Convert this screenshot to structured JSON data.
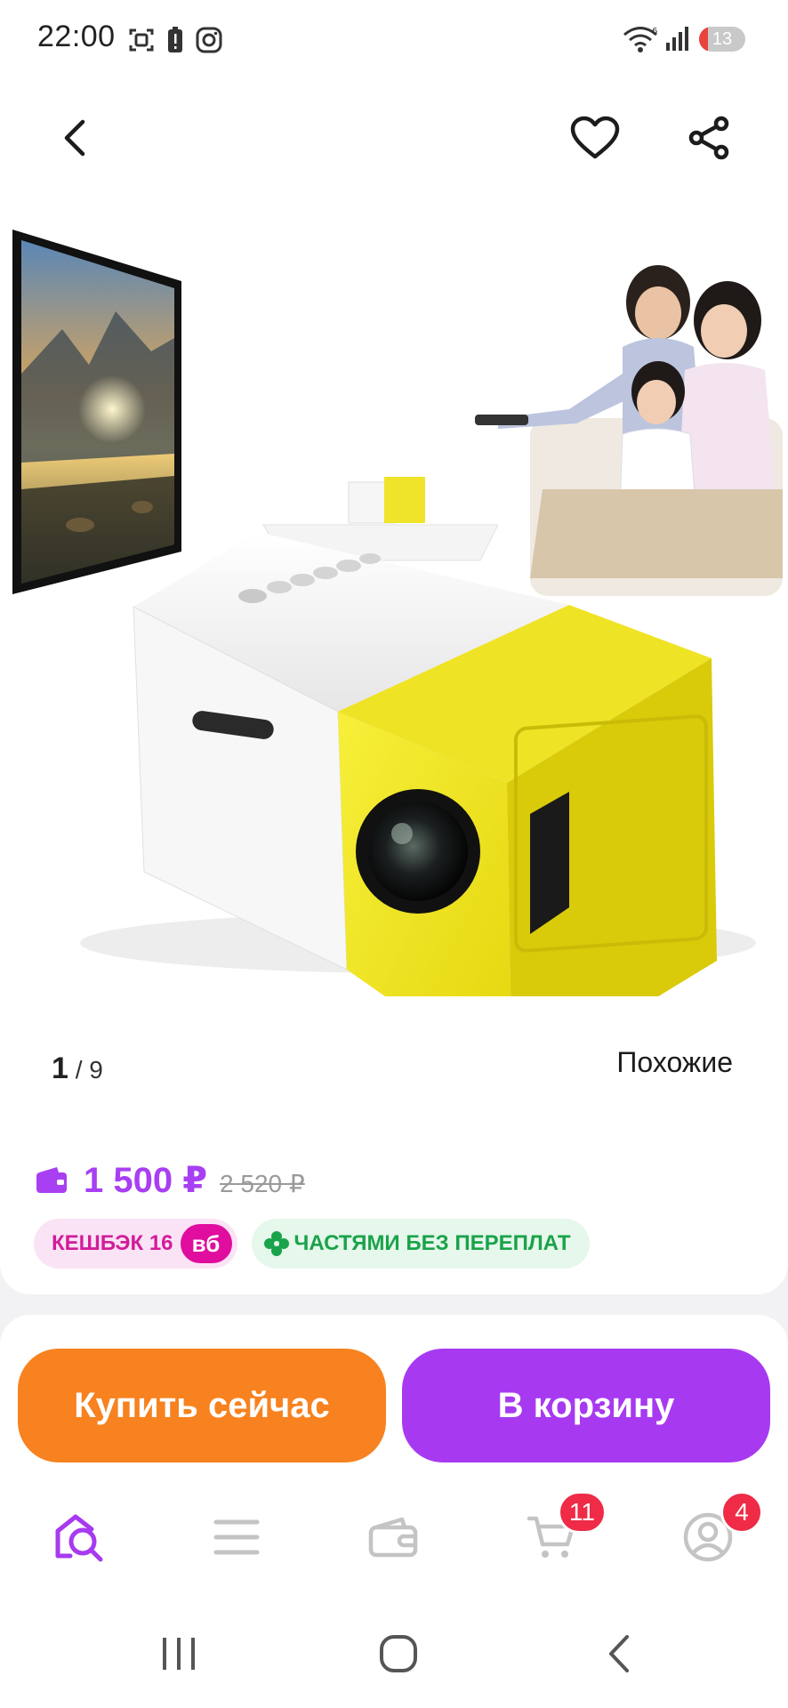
{
  "status_bar": {
    "time": "22:00",
    "battery_level": "13",
    "icons": [
      "screenshot-icon",
      "battery-alert-icon",
      "instagram-icon",
      "wifi-icon",
      "signal-icon"
    ]
  },
  "top_nav": {
    "icons": [
      "back-arrow-icon",
      "heart-icon",
      "share-icon"
    ]
  },
  "gallery": {
    "current": "1",
    "separator": " / ",
    "total": "9",
    "similar_label": "Похожие"
  },
  "price": {
    "current": "1 500 ₽",
    "old": "2 520 ₽",
    "accent_color": "#a83ff2"
  },
  "badges": {
    "cashback_label": "КЕШБЭК 16",
    "cashback_tag": "вб",
    "installments_label": "ЧАСТЯМИ БЕЗ ПЕРЕПЛАТ"
  },
  "actions": {
    "buy_now_label": "Купить сейчас",
    "buy_now_color": "#f7821f",
    "add_to_cart_label": "В корзину",
    "add_to_cart_color": "#a73af1"
  },
  "tab_bar": {
    "tabs": [
      {
        "name": "home-search-icon",
        "active": true
      },
      {
        "name": "menu-icon",
        "active": false
      },
      {
        "name": "wallet-icon",
        "active": false
      },
      {
        "name": "cart-icon",
        "active": false,
        "badge": "11"
      },
      {
        "name": "profile-icon",
        "active": false,
        "badge": "4"
      }
    ]
  },
  "system_nav": {
    "icons": [
      "recents-icon",
      "home-icon",
      "back-icon"
    ]
  }
}
